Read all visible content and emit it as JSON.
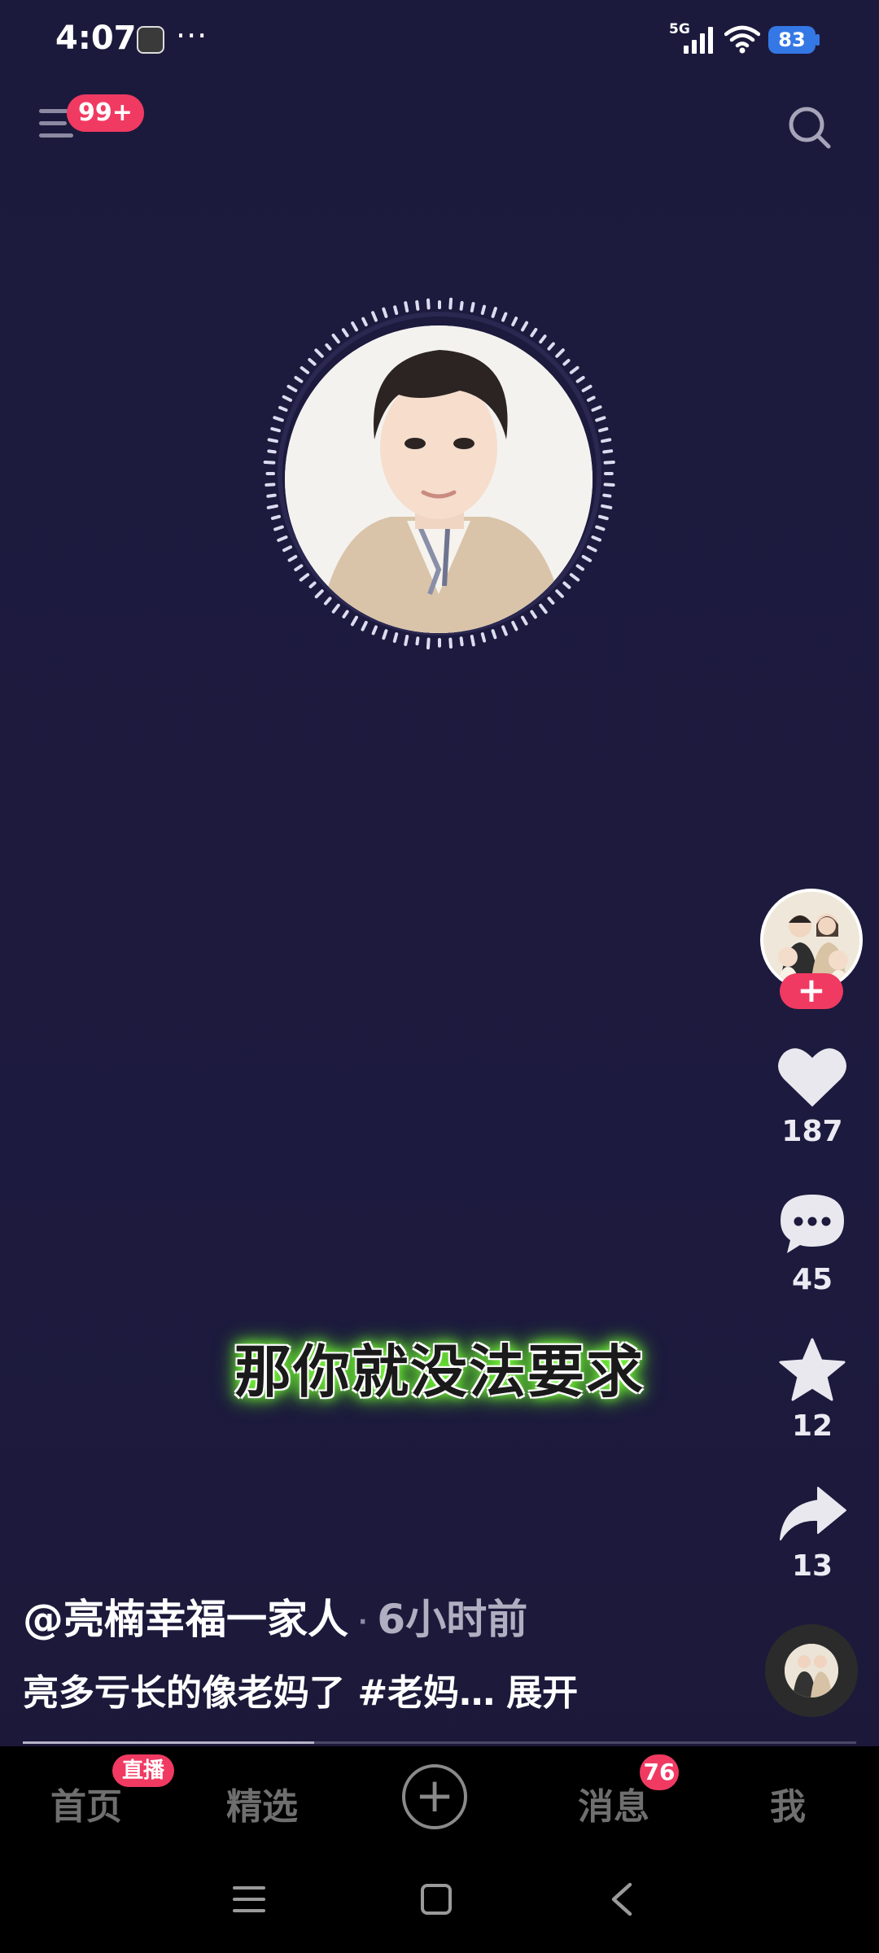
{
  "status_bar": {
    "time": "4:07",
    "dots": "···",
    "network": "5G",
    "battery": "83"
  },
  "top_bar": {
    "notification_badge": "99+",
    "menu_icon": "hamburger-menu-icon",
    "search_icon": "search-icon"
  },
  "subtitle": "那你就没法要求",
  "rail": {
    "follow_label": "+",
    "likes": "187",
    "comments": "45",
    "favorites": "12",
    "shares": "13"
  },
  "caption": {
    "author": "@亮楠幸福一家人",
    "separator": "·",
    "time": "6小时前",
    "description": "亮多亏长的像老妈了 #老妈…",
    "expand": "展开"
  },
  "progress": {
    "fraction": 0.35
  },
  "bottom_nav": {
    "home": "首页",
    "live_badge": "直播",
    "featured": "精选",
    "create": "+",
    "messages": "消息",
    "messages_badge": "76",
    "me": "我"
  },
  "colors": {
    "background": "#1d1a3d",
    "accent": "#f03a62",
    "subtitle_glow": "#6cff2a"
  }
}
